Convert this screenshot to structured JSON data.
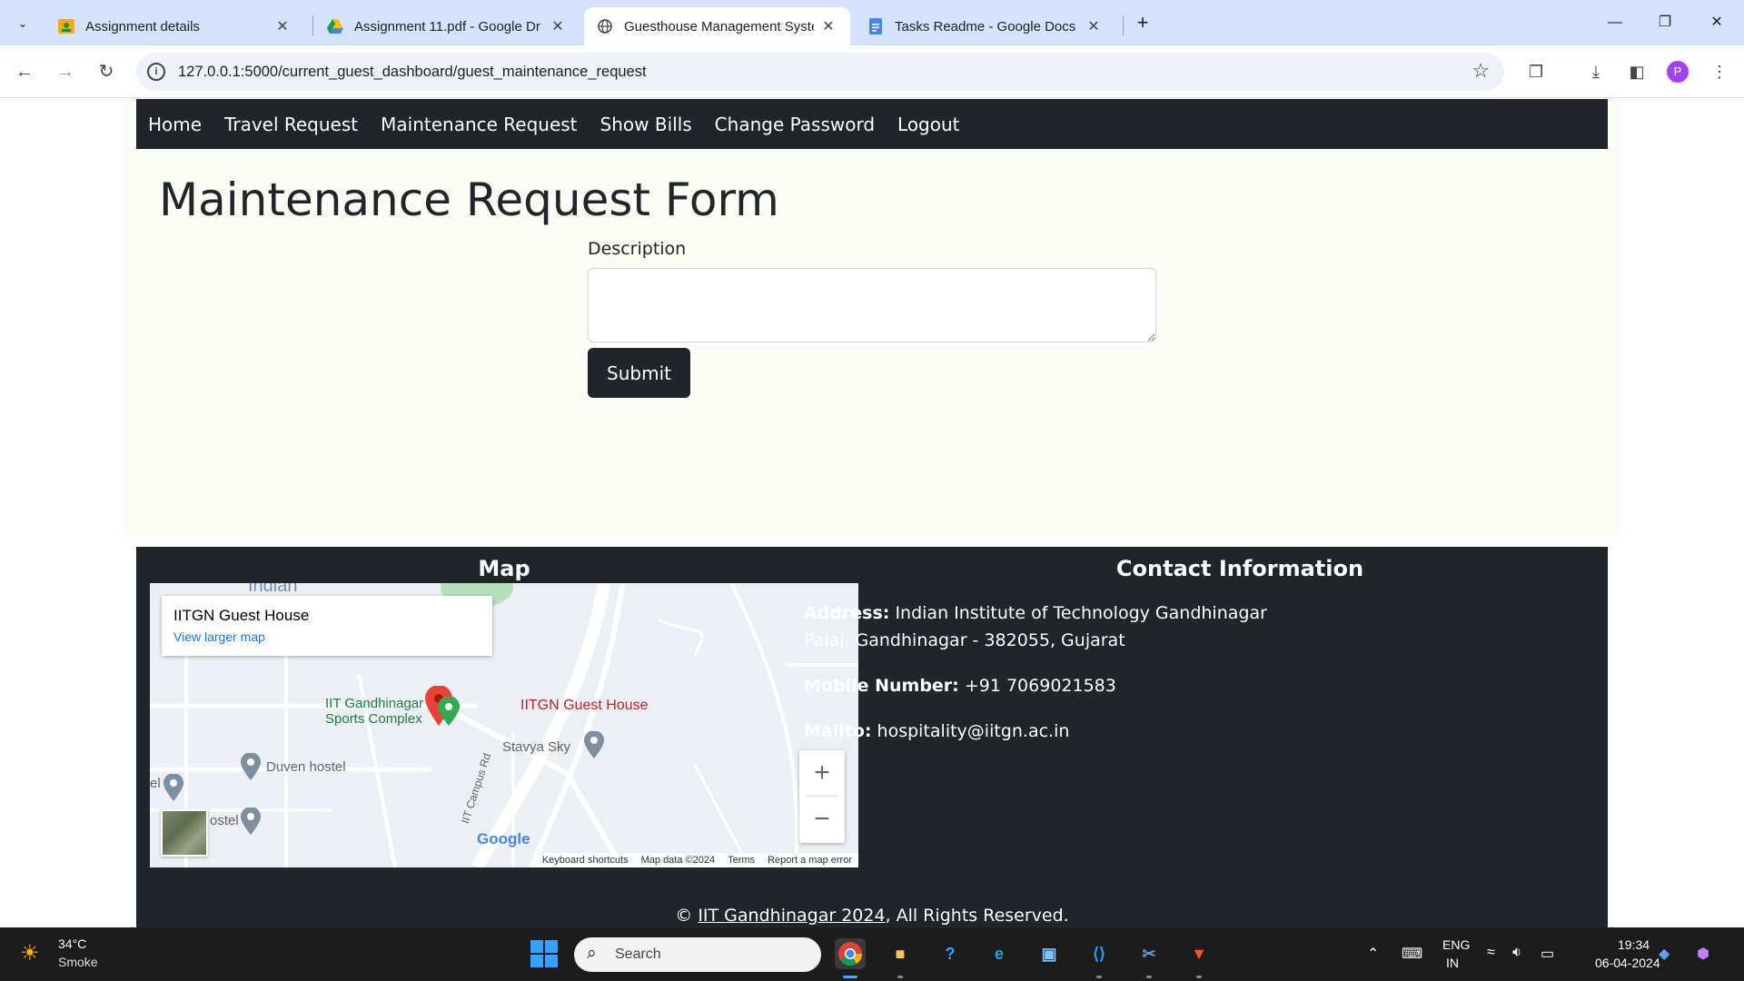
{
  "browser": {
    "tabs": [
      {
        "title": "Assignment details",
        "icon": "classroom-icon"
      },
      {
        "title": "Assignment 11.pdf - Google Dr",
        "icon": "drive-icon"
      },
      {
        "title": "Guesthouse Management Syste",
        "icon": "globe-icon",
        "active": true
      },
      {
        "title": "Tasks Readme - Google Docs",
        "icon": "docs-icon"
      }
    ],
    "url": "127.0.0.1:5000/current_guest_dashboard/guest_maintenance_request",
    "profile_initial": "P"
  },
  "nav": {
    "items": [
      "Home",
      "Travel Request",
      "Maintenance Request",
      "Show Bills",
      "Change Password",
      "Logout"
    ]
  },
  "form": {
    "title": "Maintenance Request Form",
    "description_label": "Description",
    "description_value": "",
    "submit_label": "Submit"
  },
  "footer": {
    "map_heading": "Map",
    "contact_heading": "Contact Information",
    "map": {
      "place_name": "IITGN Guest House",
      "view_larger": "View larger map",
      "labels": {
        "marker": "IITGN Guest House",
        "sports_line1": "IIT Gandhinagar",
        "sports_line2": "Sports Complex",
        "stavya": "Stavya Sky",
        "duven": "Duven hostel",
        "indian": "Indian",
        "road": "IIT Campus Rd",
        "hostel_partial": "ostel",
        "el_partial": "el"
      },
      "google": "Google",
      "attribution": [
        "Keyboard shortcuts",
        "Map data ©2024",
        "Terms",
        "Report a map error"
      ]
    },
    "contact": {
      "address_label": "Address:",
      "address_line1": "Indian Institute of Technology Gandhinagar",
      "address_line2": "Palaj, Gandhinagar - 382055, Gujarat",
      "mobile_label": "Mobile Number:",
      "mobile": "+91 7069021583",
      "mail_label": "Mailto:",
      "mail": "hospitality@iitgn.ac.in"
    },
    "copyright_prefix": "©",
    "copyright_link": "IIT Gandhinagar 2024",
    "copyright_suffix": ", All Rights Reserved."
  },
  "taskbar": {
    "weather_temp": "34°C",
    "weather_desc": "Smoke",
    "search_placeholder": "Search",
    "lang_line1": "ENG",
    "lang_line2": "IN",
    "time": "19:34",
    "date": "06-04-2024"
  },
  "colors": {
    "navbar": "#212529",
    "page_bg": "#fcfcf6",
    "tabbar": "#d3e3fd",
    "taskbar": "#1c1c1c"
  }
}
